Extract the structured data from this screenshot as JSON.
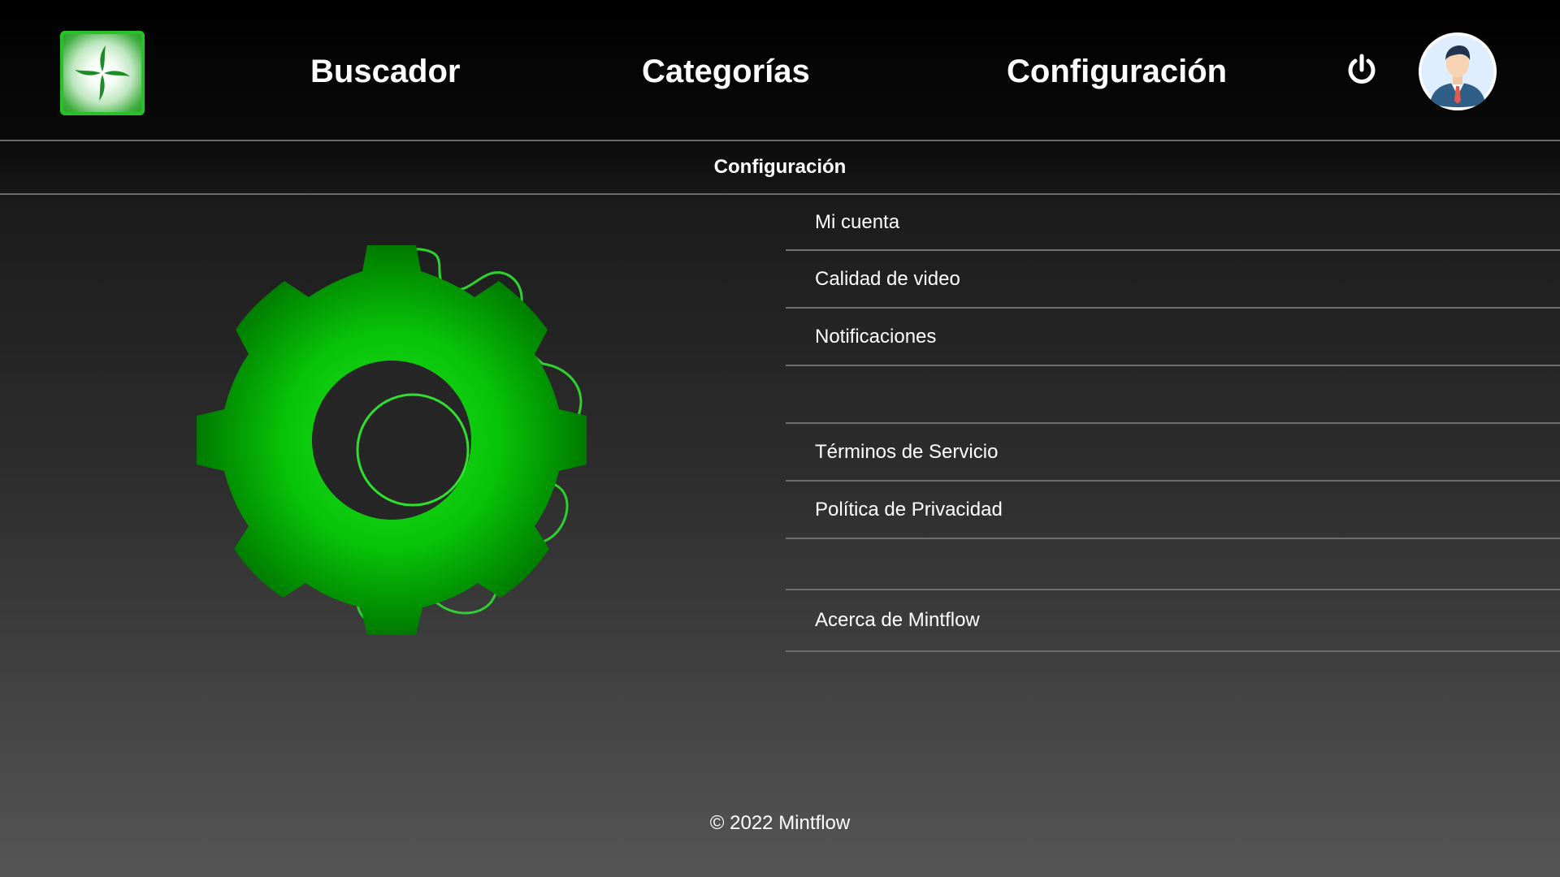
{
  "header": {
    "logo_icon": "pinwheel-leaf-icon",
    "nav": [
      {
        "label": "Buscador"
      },
      {
        "label": "Categorías"
      },
      {
        "label": "Configuración"
      }
    ],
    "power_icon": "power-icon",
    "avatar_icon": "user-avatar-icon"
  },
  "section": {
    "title": "Configuración"
  },
  "illustration": {
    "icon": "gear-icon",
    "accent_color": "#00cc00"
  },
  "menu": {
    "items": [
      {
        "label": "Mi cuenta"
      },
      {
        "label": "Calidad de video"
      },
      {
        "label": "Notificaciones"
      },
      {
        "label": ""
      },
      {
        "label": "Términos de Servicio"
      },
      {
        "label": "Política de Privacidad"
      },
      {
        "label": ""
      },
      {
        "label": "Acerca de Mintflow"
      }
    ]
  },
  "footer": {
    "text": "© 2022 Mintflow"
  },
  "colors": {
    "brand_green": "#2bbf2b",
    "divider": "#6e6e6e",
    "text": "#ffffff"
  }
}
